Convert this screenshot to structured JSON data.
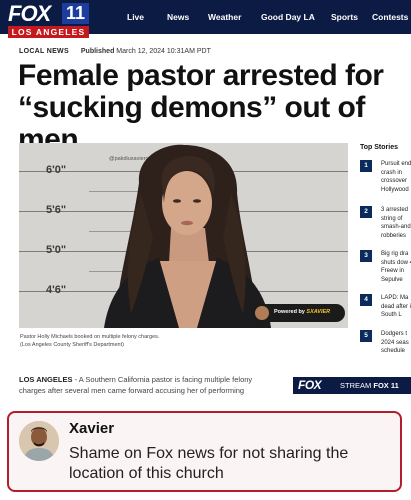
{
  "header": {
    "logo": {
      "brand": "FOX",
      "number": "11",
      "city": "LOS ANGELES"
    },
    "nav": [
      "Live",
      "News",
      "Weather",
      "Good Day LA",
      "Sports",
      "Contests"
    ]
  },
  "article": {
    "section": "LOCAL NEWS",
    "published_label": "Published",
    "published_date": "March 12, 2024 10:31AM PDT",
    "headline": "Female pastor arrested for “sucking demons” out of men",
    "photo": {
      "heights": [
        "6'0\"",
        "5'6\"",
        "5'0\"",
        "4'6\""
      ],
      "handle": "@pakdiuxavierog",
      "badge_prefix": "Powered by",
      "badge_brand": "SXAVIER"
    },
    "caption_line1": "Pastor Holly Michaels booked on multiple felony charges.",
    "caption_line2": "(Los Angeles County Sheriff's Department)",
    "dateline": "LOS ANGELES",
    "body": " - A Southern California pastor is facing multiple felony charges after several men came forward accusing her of performing"
  },
  "sidebar": {
    "title": "Top Stories",
    "items": [
      {
        "num": "1",
        "text": "Pursuit end crash in crossover Hollywood"
      },
      {
        "num": "2",
        "text": "3 arrested string of smash-and robberies"
      },
      {
        "num": "3",
        "text": "Big rig dra shuts dow 405 Freew in Sepulve"
      },
      {
        "num": "4",
        "text": "LAPD: Ma dead after in South L"
      },
      {
        "num": "5",
        "text": "Dodgers t 2024 seas schedule"
      }
    ]
  },
  "stream_banner": {
    "brand": "FOX",
    "label": "STREAM",
    "channel": "FOX 11"
  },
  "comment": {
    "author": "Xavier",
    "text": "Shame on Fox news for not sharing the location of this church"
  }
}
